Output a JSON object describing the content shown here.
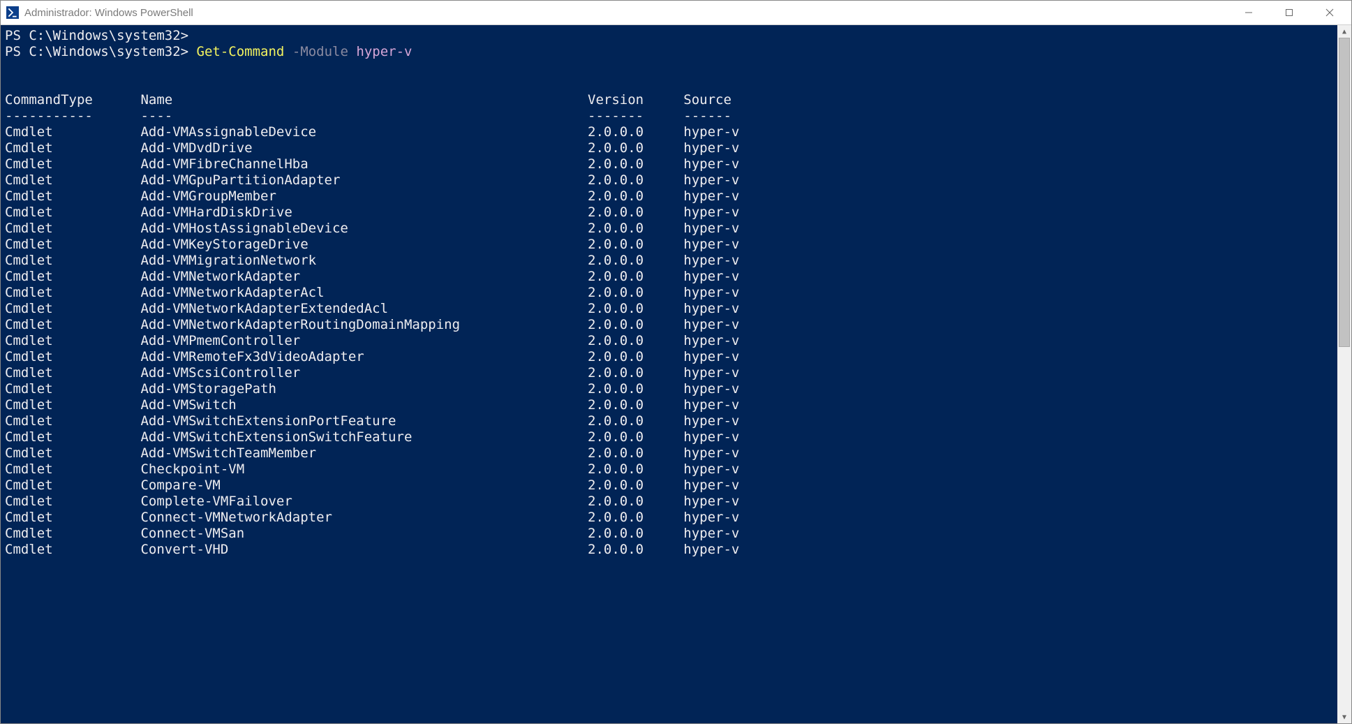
{
  "window": {
    "title": "Administrador: Windows PowerShell"
  },
  "prompt": {
    "line1": "PS C:\\Windows\\system32>",
    "line2_prefix": "PS C:\\Windows\\system32> ",
    "command": "Get-Command",
    "param_flag": "-Module",
    "param_value": "hyper-v"
  },
  "headers": {
    "type": "CommandType",
    "name": "Name",
    "version": "Version",
    "source": "Source"
  },
  "dividers": {
    "type": "-----------",
    "name": "----",
    "version": "-------",
    "source": "------"
  },
  "rows": [
    {
      "type": "Cmdlet",
      "name": "Add-VMAssignableDevice",
      "version": "2.0.0.0",
      "source": "hyper-v"
    },
    {
      "type": "Cmdlet",
      "name": "Add-VMDvdDrive",
      "version": "2.0.0.0",
      "source": "hyper-v"
    },
    {
      "type": "Cmdlet",
      "name": "Add-VMFibreChannelHba",
      "version": "2.0.0.0",
      "source": "hyper-v"
    },
    {
      "type": "Cmdlet",
      "name": "Add-VMGpuPartitionAdapter",
      "version": "2.0.0.0",
      "source": "hyper-v"
    },
    {
      "type": "Cmdlet",
      "name": "Add-VMGroupMember",
      "version": "2.0.0.0",
      "source": "hyper-v"
    },
    {
      "type": "Cmdlet",
      "name": "Add-VMHardDiskDrive",
      "version": "2.0.0.0",
      "source": "hyper-v"
    },
    {
      "type": "Cmdlet",
      "name": "Add-VMHostAssignableDevice",
      "version": "2.0.0.0",
      "source": "hyper-v"
    },
    {
      "type": "Cmdlet",
      "name": "Add-VMKeyStorageDrive",
      "version": "2.0.0.0",
      "source": "hyper-v"
    },
    {
      "type": "Cmdlet",
      "name": "Add-VMMigrationNetwork",
      "version": "2.0.0.0",
      "source": "hyper-v"
    },
    {
      "type": "Cmdlet",
      "name": "Add-VMNetworkAdapter",
      "version": "2.0.0.0",
      "source": "hyper-v"
    },
    {
      "type": "Cmdlet",
      "name": "Add-VMNetworkAdapterAcl",
      "version": "2.0.0.0",
      "source": "hyper-v"
    },
    {
      "type": "Cmdlet",
      "name": "Add-VMNetworkAdapterExtendedAcl",
      "version": "2.0.0.0",
      "source": "hyper-v"
    },
    {
      "type": "Cmdlet",
      "name": "Add-VMNetworkAdapterRoutingDomainMapping",
      "version": "2.0.0.0",
      "source": "hyper-v"
    },
    {
      "type": "Cmdlet",
      "name": "Add-VMPmemController",
      "version": "2.0.0.0",
      "source": "hyper-v"
    },
    {
      "type": "Cmdlet",
      "name": "Add-VMRemoteFx3dVideoAdapter",
      "version": "2.0.0.0",
      "source": "hyper-v"
    },
    {
      "type": "Cmdlet",
      "name": "Add-VMScsiController",
      "version": "2.0.0.0",
      "source": "hyper-v"
    },
    {
      "type": "Cmdlet",
      "name": "Add-VMStoragePath",
      "version": "2.0.0.0",
      "source": "hyper-v"
    },
    {
      "type": "Cmdlet",
      "name": "Add-VMSwitch",
      "version": "2.0.0.0",
      "source": "hyper-v"
    },
    {
      "type": "Cmdlet",
      "name": "Add-VMSwitchExtensionPortFeature",
      "version": "2.0.0.0",
      "source": "hyper-v"
    },
    {
      "type": "Cmdlet",
      "name": "Add-VMSwitchExtensionSwitchFeature",
      "version": "2.0.0.0",
      "source": "hyper-v"
    },
    {
      "type": "Cmdlet",
      "name": "Add-VMSwitchTeamMember",
      "version": "2.0.0.0",
      "source": "hyper-v"
    },
    {
      "type": "Cmdlet",
      "name": "Checkpoint-VM",
      "version": "2.0.0.0",
      "source": "hyper-v"
    },
    {
      "type": "Cmdlet",
      "name": "Compare-VM",
      "version": "2.0.0.0",
      "source": "hyper-v"
    },
    {
      "type": "Cmdlet",
      "name": "Complete-VMFailover",
      "version": "2.0.0.0",
      "source": "hyper-v"
    },
    {
      "type": "Cmdlet",
      "name": "Connect-VMNetworkAdapter",
      "version": "2.0.0.0",
      "source": "hyper-v"
    },
    {
      "type": "Cmdlet",
      "name": "Connect-VMSan",
      "version": "2.0.0.0",
      "source": "hyper-v"
    },
    {
      "type": "Cmdlet",
      "name": "Convert-VHD",
      "version": "2.0.0.0",
      "source": "hyper-v"
    }
  ]
}
